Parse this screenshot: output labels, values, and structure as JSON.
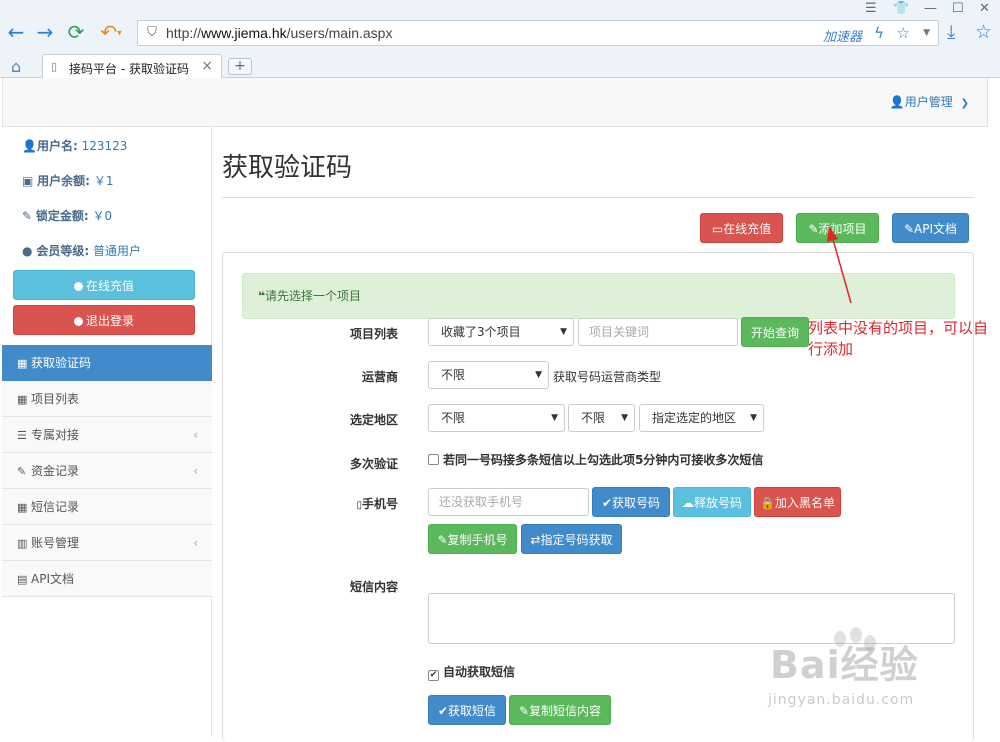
{
  "browser": {
    "url_prefix": "http://",
    "url_domain": "www.jiema.hk",
    "url_path": "/users/main.aspx",
    "accelerator": "加速器",
    "tab_title": "接码平台 - 获取验证码",
    "new_tab": "+",
    "tab_close": "×"
  },
  "topnav": {
    "user_menu": "用户管理"
  },
  "sidebar": {
    "username_label": "用户名:",
    "username_value": "123123",
    "balance_label": "用户余额:",
    "balance_value": "￥1",
    "locked_label": "锁定金额:",
    "locked_value": "￥0",
    "level_label": "会员等级:",
    "level_value": "普通用户",
    "recharge": "在线充值",
    "logout": "退出登录",
    "menu": [
      {
        "label": "获取验证码",
        "icon": "grid-icon"
      },
      {
        "label": "项目列表",
        "icon": "grid-icon"
      },
      {
        "label": "专属对接",
        "icon": "server-icon"
      },
      {
        "label": "资金记录",
        "icon": "pencil-icon"
      },
      {
        "label": "短信记录",
        "icon": "grid-icon"
      },
      {
        "label": "账号管理",
        "icon": "chart-icon"
      },
      {
        "label": "API文档",
        "icon": "film-icon"
      }
    ]
  },
  "main": {
    "title": "获取验证码",
    "btn_recharge": "在线充值",
    "btn_add_project": "添加项目",
    "btn_api": "API文档",
    "alert": "请先选择一个项目",
    "project_label": "项目列表",
    "project_select": "收藏了3个项目",
    "keyword_placeholder": "项目关键词",
    "btn_query": "开始查询",
    "operator_label": "运营商",
    "operator_select": "不限",
    "operator_help": "获取号码运营商类型",
    "region_label": "选定地区",
    "region_select1": "不限",
    "region_select2": "不限",
    "region_select3": "指定选定的地区",
    "multi_label": "多次验证",
    "multi_text": "若同一号码接多条短信以上勾选此项5分钟内可接收多次短信",
    "phone_label": "手机号",
    "phone_placeholder": "还没获取手机号",
    "btn_get_number": "获取号码",
    "btn_release": "释放号码",
    "btn_blacklist": "加入黑名单",
    "btn_copy_phone": "复制手机号",
    "btn_assign": "指定号码获取",
    "sms_label": "短信内容",
    "auto_sms": "自动获取短信",
    "btn_get_sms": "获取短信",
    "btn_copy_sms": "复制短信内容"
  },
  "annotation": {
    "text": "列表中没有的项目，可以自行添加"
  },
  "watermark": {
    "brand": "Bai经验",
    "url": "jingyan.baidu.com"
  },
  "colors": {
    "green": "#5cb85c",
    "blue": "#428bca",
    "red": "#d9534f",
    "cyan": "#5bc0de",
    "annotation": "#e0272a"
  }
}
